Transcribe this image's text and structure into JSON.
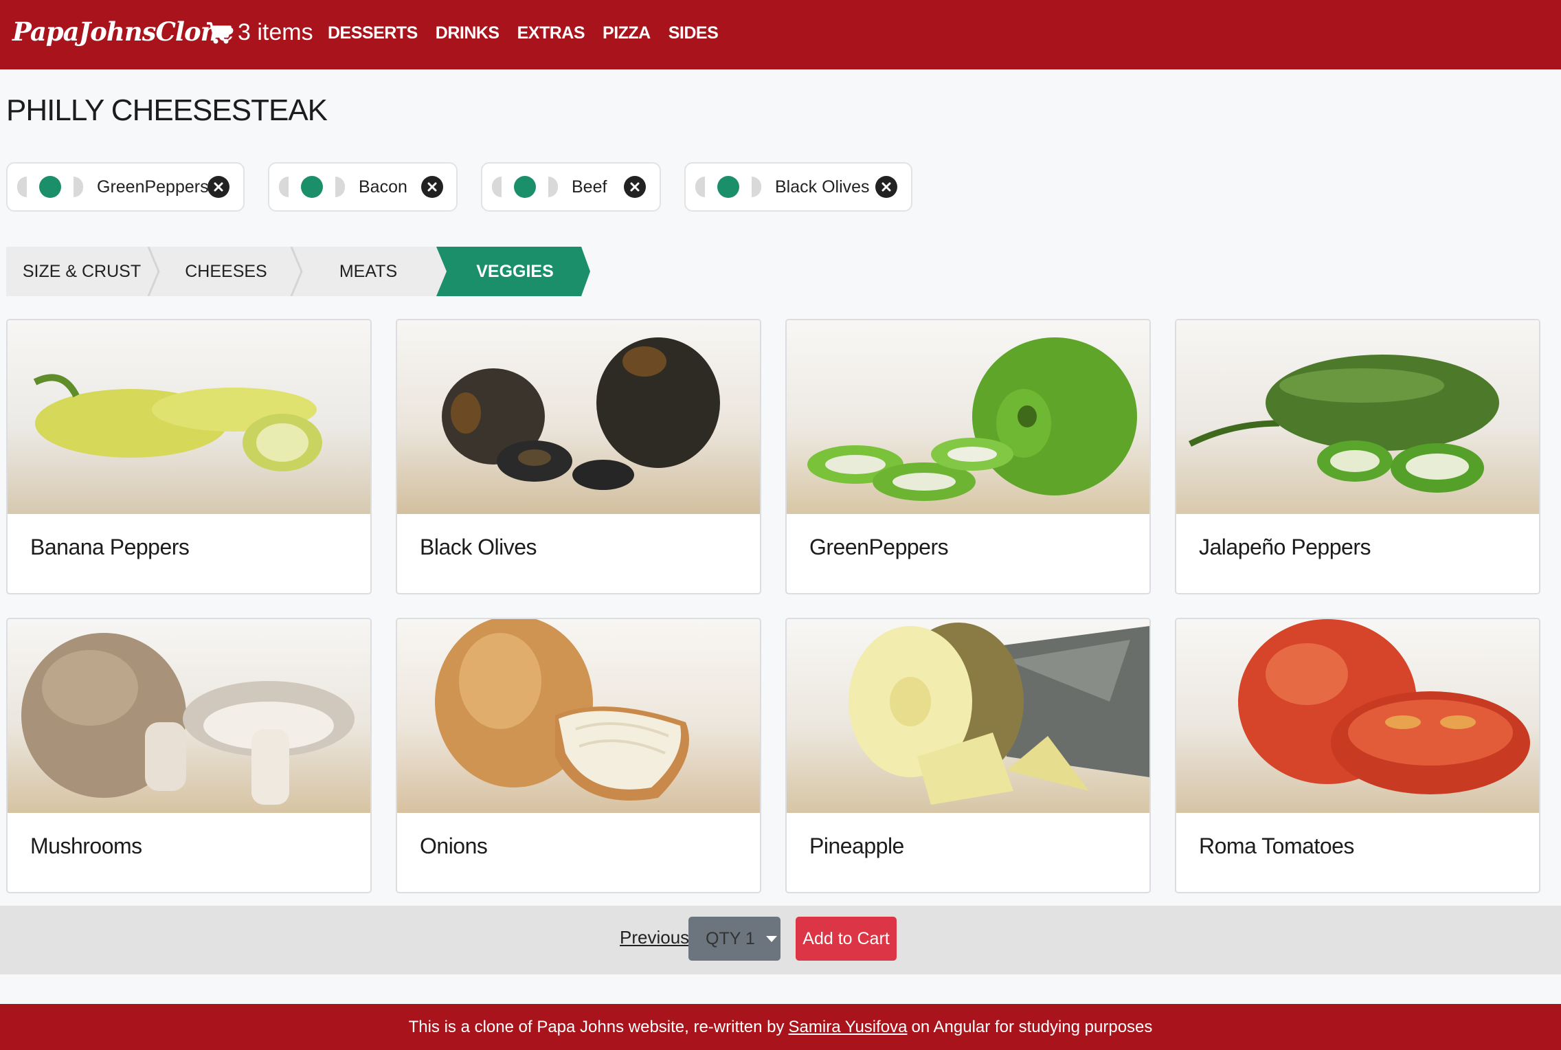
{
  "navbar": {
    "brand": "PapaJohnsClone",
    "cart_label": "3 items",
    "links": [
      "DESSERTS",
      "DRINKS",
      "EXTRAS",
      "PIZZA",
      "SIDES"
    ],
    "background": "#a9131b"
  },
  "page_title": "PHILLY CHEESESTEAK",
  "selected_toppings": [
    {
      "label": "GreenPeppers",
      "coverage": "whole"
    },
    {
      "label": "Bacon",
      "coverage": "whole"
    },
    {
      "label": "Beef",
      "coverage": "whole"
    },
    {
      "label": "Black Olives",
      "coverage": "whole"
    }
  ],
  "steps": [
    {
      "label": "SIZE & CRUST",
      "active": false
    },
    {
      "label": "CHEESES",
      "active": false
    },
    {
      "label": "MEATS",
      "active": false
    },
    {
      "label": "VEGGIES",
      "active": true
    }
  ],
  "veggies": [
    {
      "name": "Banana Peppers",
      "icon": "banana-pepper-image"
    },
    {
      "name": "Black Olives",
      "icon": "black-olives-image"
    },
    {
      "name": "GreenPeppers",
      "icon": "green-pepper-image"
    },
    {
      "name": "Jalapeño Peppers",
      "icon": "jalapeno-image"
    },
    {
      "name": "Mushrooms",
      "icon": "mushroom-image"
    },
    {
      "name": "Onions",
      "icon": "onion-image"
    },
    {
      "name": "Pineapple",
      "icon": "pineapple-image"
    },
    {
      "name": "Roma Tomatoes",
      "icon": "tomato-image"
    }
  ],
  "actions": {
    "previous_label": "Previous",
    "qty_label": "QTY 1",
    "add_to_cart_label": "Add to Cart"
  },
  "footer": {
    "text_before": "This is a clone of Papa Johns website, re-written by",
    "author": "Samira Yusifova",
    "text_after": "on Angular for studying purposes"
  },
  "colors": {
    "brand_red": "#a9131b",
    "accent_green": "#1b8f6a",
    "add_red": "#dc3545",
    "qty_gray": "#6c757d"
  }
}
